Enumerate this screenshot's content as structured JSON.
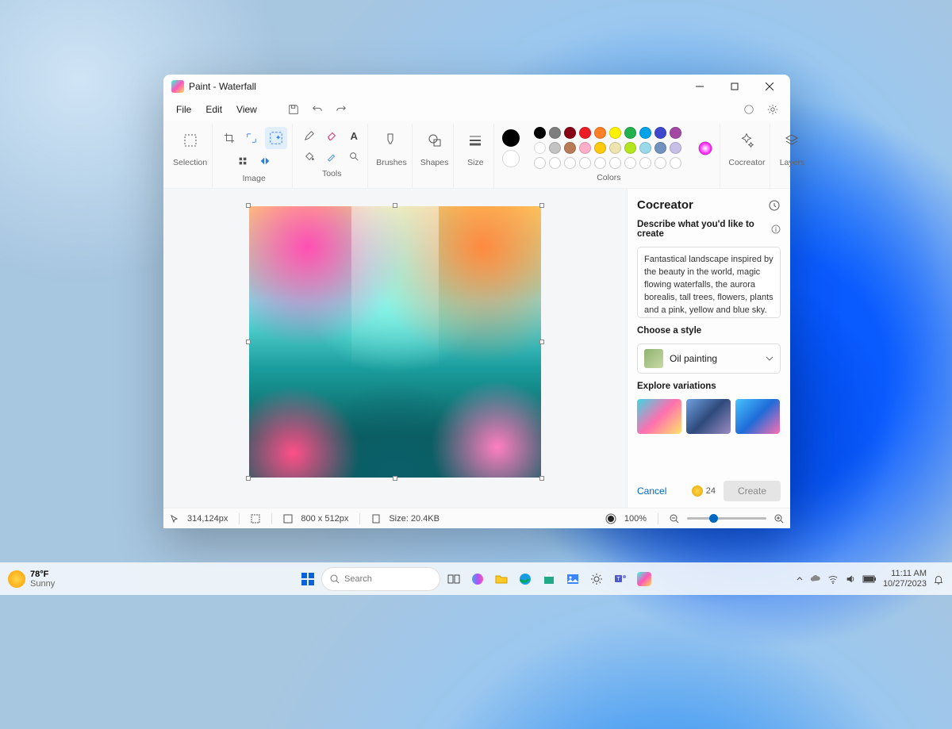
{
  "window": {
    "title": "Paint - Waterfall",
    "menus": {
      "file": "File",
      "edit": "Edit",
      "view": "View"
    }
  },
  "ribbon": {
    "selection": "Selection",
    "image": "Image",
    "tools": "Tools",
    "brushes": "Brushes",
    "shapes": "Shapes",
    "size": "Size",
    "colors": "Colors",
    "cocreator": "Cocreator",
    "layers": "Layers"
  },
  "palette": {
    "row1": [
      "#000000",
      "#7f7f7f",
      "#880015",
      "#ed1c24",
      "#ff7f27",
      "#fff200",
      "#22b14c",
      "#00a2e8",
      "#3f48cc",
      "#a349a4"
    ],
    "row2": [
      "#ffffff",
      "#c3c3c3",
      "#b97a57",
      "#ffaec9",
      "#ffc90e",
      "#efe4b0",
      "#b5e61d",
      "#99d9ea",
      "#7092be",
      "#c8bfe7"
    ],
    "current1": "#000000",
    "current2": "#ffffff"
  },
  "cocreator": {
    "title": "Cocreator",
    "describe_label": "Describe what you'd like to create",
    "prompt": "Fantastical landscape inspired by the beauty in the world, magic flowing waterfalls, the aurora borealis, tall trees, flowers, plants and a pink, yellow and blue sky.",
    "style_label": "Choose a style",
    "style_value": "Oil painting",
    "variations_label": "Explore variations",
    "cancel": "Cancel",
    "credits": "24",
    "create": "Create"
  },
  "status": {
    "cursor": "314,124px",
    "canvas_size": "800  x  512px",
    "file_size": "Size: 20.4KB",
    "zoom": "100%"
  },
  "taskbar": {
    "temp": "78°F",
    "condition": "Sunny",
    "search_placeholder": "Search",
    "time": "11:11 AM",
    "date": "10/27/2023"
  }
}
